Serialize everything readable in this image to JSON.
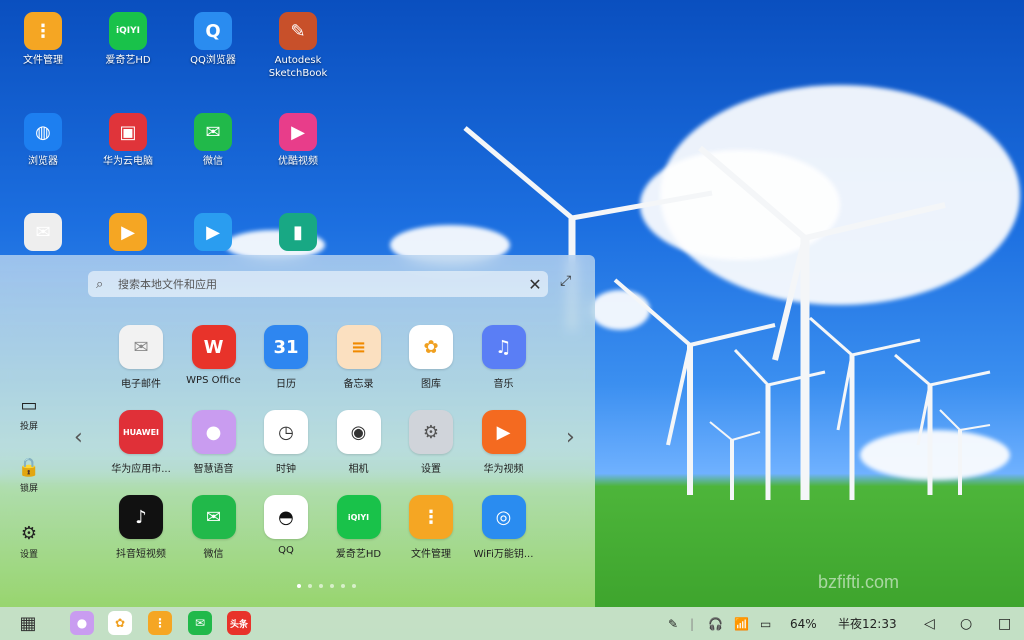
{
  "desktop": {
    "icons": [
      {
        "label": "文件管理",
        "glyph": "⋮",
        "color": "#f5a623"
      },
      {
        "label": "爱奇艺HD",
        "glyph": "iQIYI",
        "color": "#19c24a"
      },
      {
        "label": "QQ浏览器",
        "glyph": "Q",
        "color": "#2a8cf0"
      },
      {
        "label": "Autodesk\nSketchBook",
        "glyph": "✎",
        "color": "#c8502a"
      },
      {
        "label": "浏览器",
        "glyph": "◍",
        "color": "#1d7ff0"
      },
      {
        "label": "华为云电脑",
        "glyph": "▣",
        "color": "#e0343a"
      },
      {
        "label": "微信",
        "glyph": "✉",
        "color": "#21b94a"
      },
      {
        "label": "优酷视频",
        "glyph": "▶",
        "color": "#e83d8a"
      },
      {
        "label": "",
        "glyph": "✉",
        "color": "#eeeeee"
      },
      {
        "label": "",
        "glyph": "▶",
        "color": "#f5a623"
      },
      {
        "label": "",
        "glyph": "▶",
        "color": "#2a9df0"
      },
      {
        "label": "",
        "glyph": "▮",
        "color": "#18a884"
      }
    ]
  },
  "launcher": {
    "search_placeholder": "搜索本地文件和应用",
    "side": [
      {
        "label": "投屏",
        "icon": "laptop-icon",
        "glyph": "▭"
      },
      {
        "label": "锁屏",
        "icon": "lock-icon",
        "glyph": "🔒"
      },
      {
        "label": "设置",
        "icon": "gear-icon",
        "glyph": "⚙"
      }
    ],
    "apps": [
      {
        "label": "电子邮件",
        "glyph": "✉",
        "color": "#f2f2f2",
        "fg": "#888"
      },
      {
        "label": "WPS Office",
        "glyph": "W",
        "color": "#e8332a",
        "fg": "#fff"
      },
      {
        "label": "日历",
        "glyph": "31",
        "color": "#2e86f0",
        "fg": "#fff"
      },
      {
        "label": "备忘录",
        "glyph": "≡",
        "color": "#fbe0c0",
        "fg": "#f08a00"
      },
      {
        "label": "图库",
        "glyph": "✿",
        "color": "#ffffff",
        "fg": "#f0a020"
      },
      {
        "label": "音乐",
        "glyph": "♫",
        "color": "#5a7ef5",
        "fg": "#fff"
      },
      {
        "label": "华为应用市...",
        "glyph": "HUAWEI",
        "color": "#e03038",
        "fg": "#fff"
      },
      {
        "label": "智慧语音",
        "glyph": "●",
        "color": "#c99cf0",
        "fg": "#fff"
      },
      {
        "label": "时钟",
        "glyph": "◷",
        "color": "#ffffff",
        "fg": "#333"
      },
      {
        "label": "相机",
        "glyph": "◉",
        "color": "#ffffff",
        "fg": "#333"
      },
      {
        "label": "设置",
        "glyph": "⚙",
        "color": "#d0d4da",
        "fg": "#555"
      },
      {
        "label": "华为视频",
        "glyph": "▶",
        "color": "#f46a20",
        "fg": "#fff"
      },
      {
        "label": "抖音短视频",
        "glyph": "♪",
        "color": "#111111",
        "fg": "#fff"
      },
      {
        "label": "微信",
        "glyph": "✉",
        "color": "#21b94a",
        "fg": "#fff"
      },
      {
        "label": "QQ",
        "glyph": "◓",
        "color": "#ffffff",
        "fg": "#111"
      },
      {
        "label": "爱奇艺HD",
        "glyph": "iQIYI",
        "color": "#19c24a",
        "fg": "#fff"
      },
      {
        "label": "文件管理",
        "glyph": "⋮",
        "color": "#f5a623",
        "fg": "#fff"
      },
      {
        "label": "WiFi万能钥...",
        "glyph": "◎",
        "color": "#2a8cf0",
        "fg": "#fff"
      }
    ],
    "page_count": 6,
    "active_page": 1
  },
  "taskbar": {
    "apps": [
      {
        "name": "launcher-button",
        "glyph": "▦",
        "color": "transparent",
        "fg": "#333"
      },
      {
        "name": "voice-assistant",
        "glyph": "●",
        "color": "#c99cf0",
        "fg": "#fff"
      },
      {
        "name": "gallery",
        "glyph": "✿",
        "color": "#ffffff",
        "fg": "#f0a020"
      },
      {
        "name": "file-manager",
        "glyph": "⋮",
        "color": "#f5a623",
        "fg": "#fff"
      },
      {
        "name": "wechat",
        "glyph": "✉",
        "color": "#21b94a",
        "fg": "#fff"
      },
      {
        "name": "toutiao",
        "glyph": "头条",
        "color": "#e8332a",
        "fg": "#fff"
      }
    ],
    "battery": "64%",
    "time": "半夜12:33"
  },
  "watermark": "bzfifti.com"
}
